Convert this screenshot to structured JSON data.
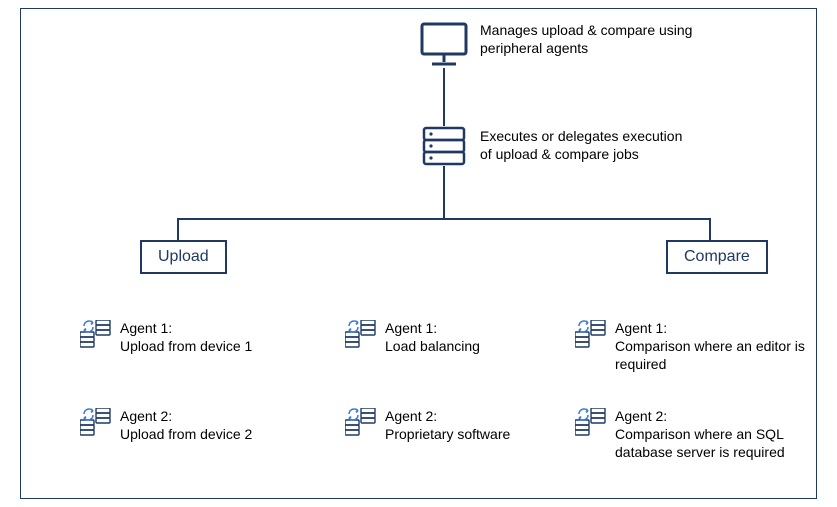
{
  "top": {
    "manager_desc_l1": "Manages upload & compare using",
    "manager_desc_l2": "peripheral agents",
    "server_desc_l1": "Executes or delegates execution",
    "server_desc_l2": "of upload & compare jobs"
  },
  "branches": {
    "upload_label": "Upload",
    "compare_label": "Compare"
  },
  "agents": {
    "col1": [
      {
        "title": "Agent 1:",
        "desc": "Upload from device 1"
      },
      {
        "title": "Agent 2:",
        "desc": "Upload from device 2"
      }
    ],
    "col2": [
      {
        "title": "Agent 1:",
        "desc": "Load balancing"
      },
      {
        "title": "Agent 2:",
        "desc": "Proprietary software"
      }
    ],
    "col3": [
      {
        "title": "Agent 1:",
        "desc": "Comparison where an editor is required"
      },
      {
        "title": "Agent 2:",
        "desc": "Comparison where an SQL database server is required"
      }
    ]
  }
}
